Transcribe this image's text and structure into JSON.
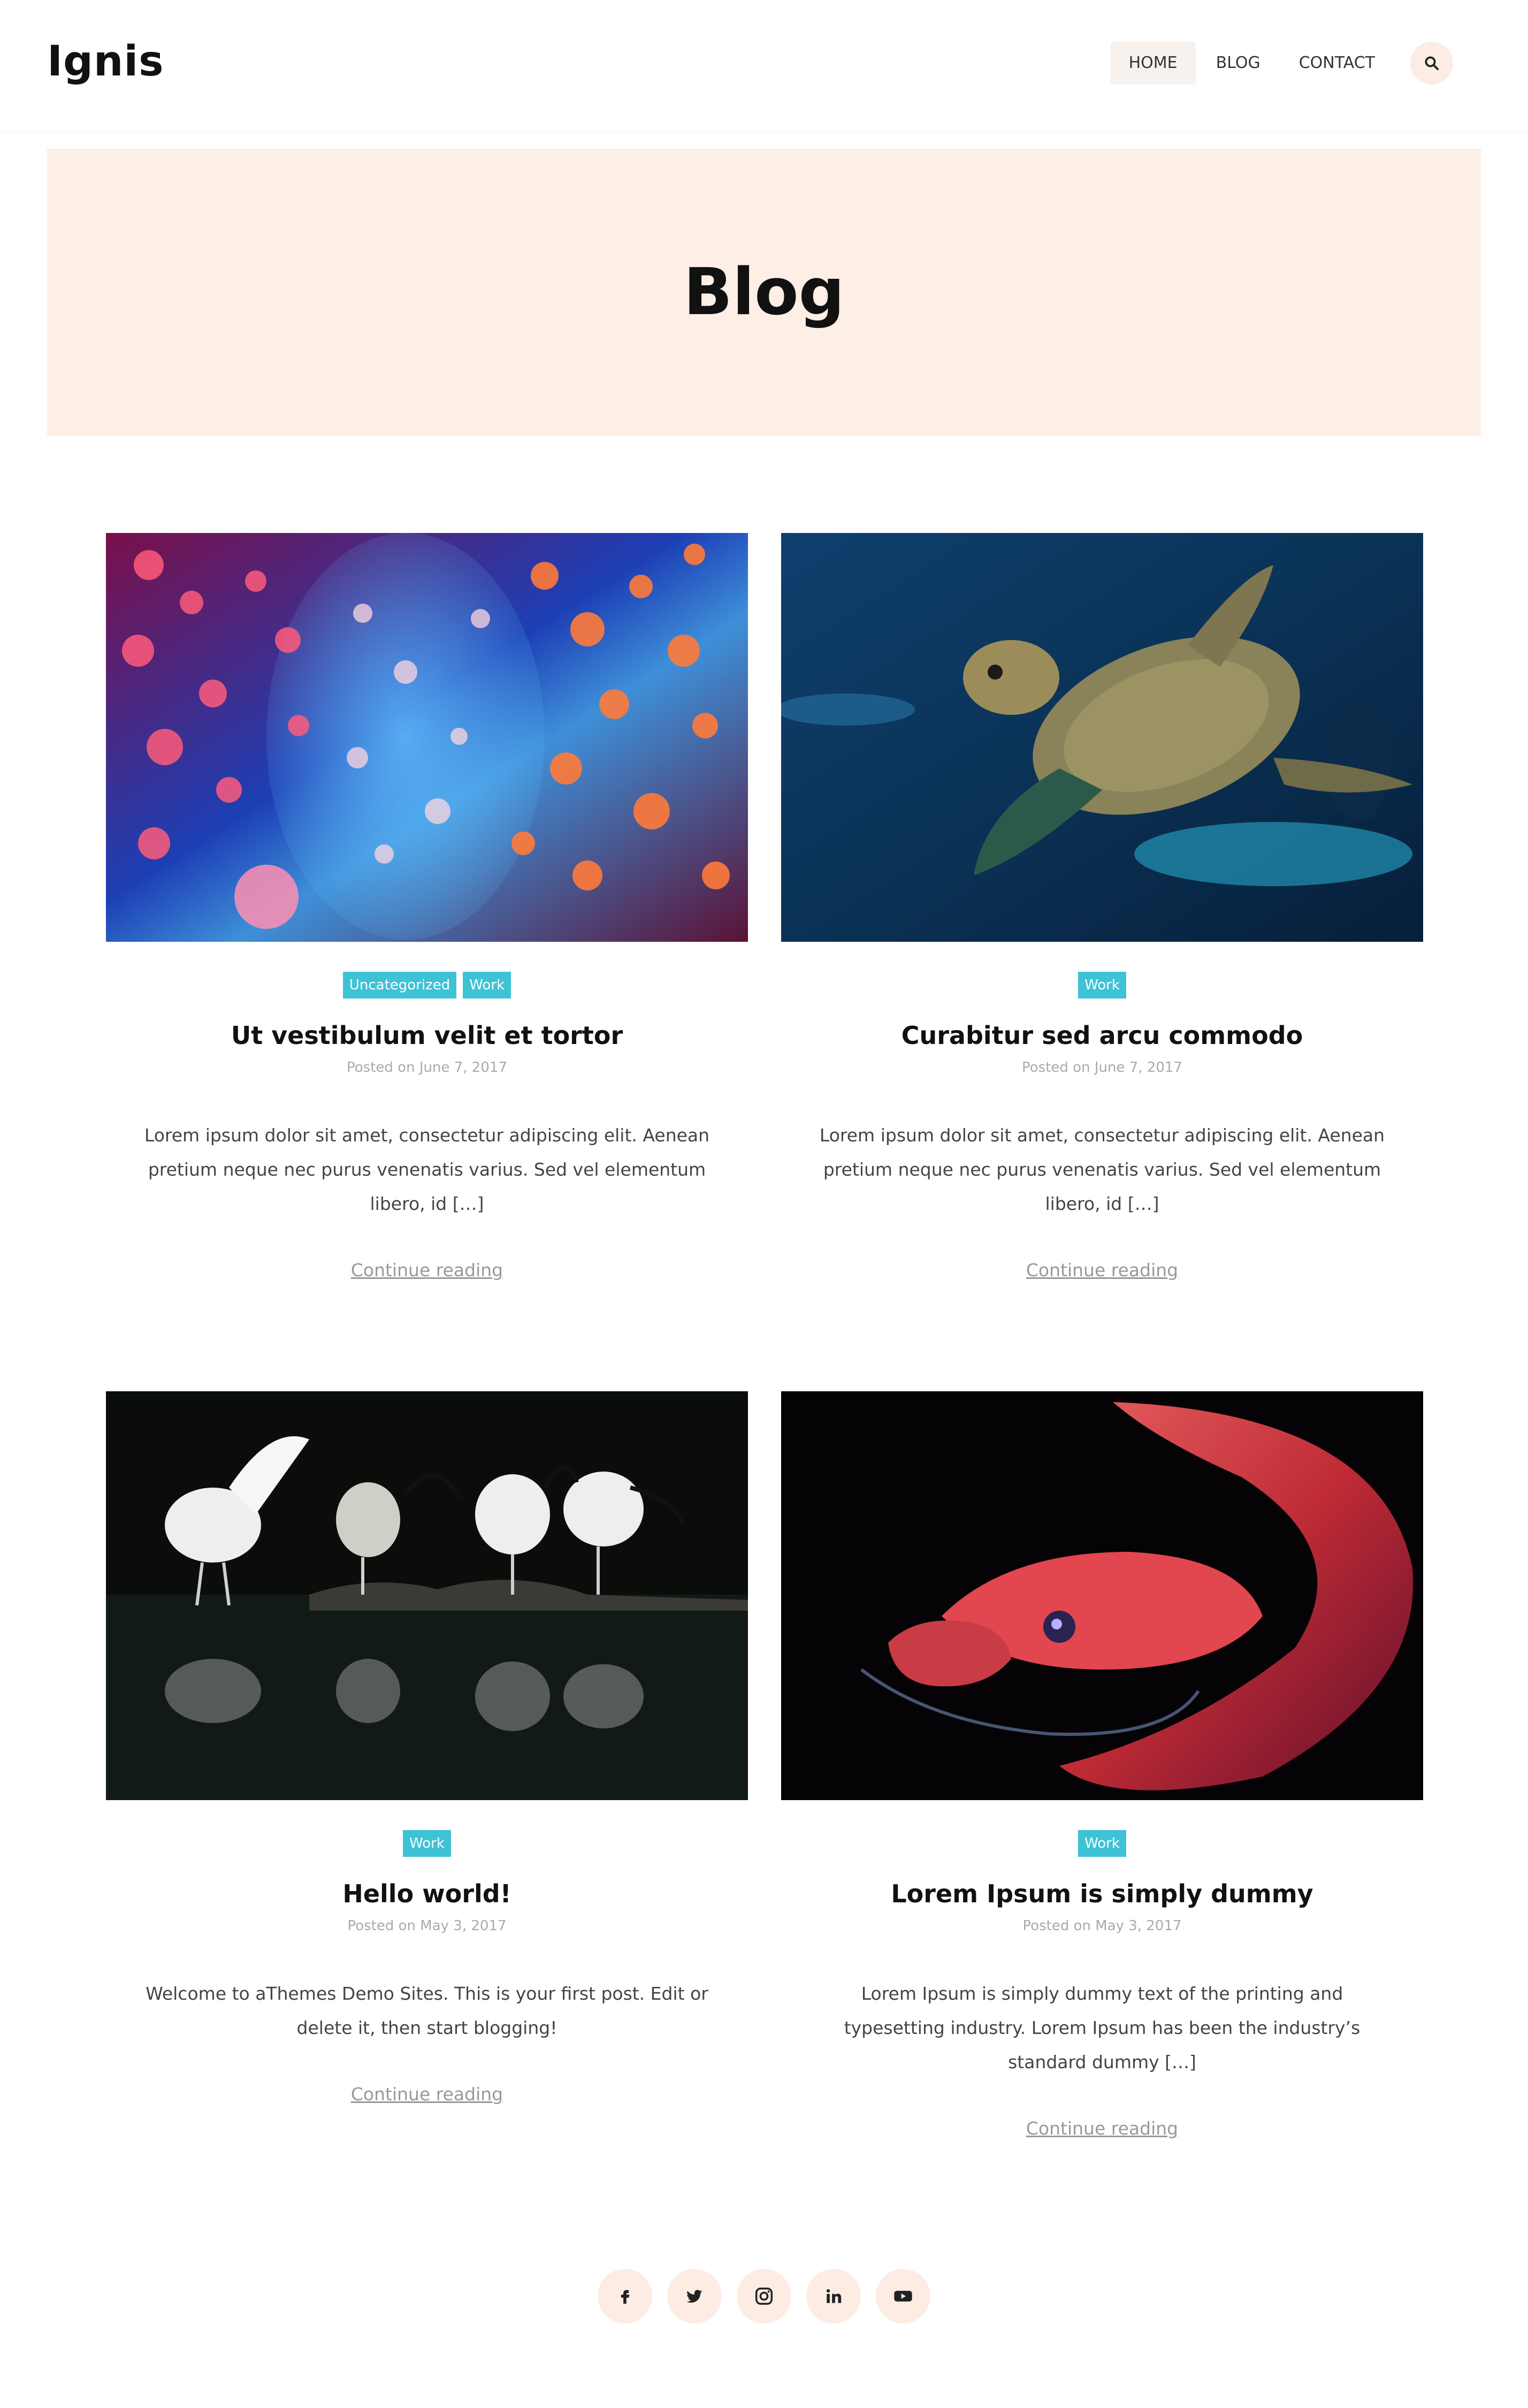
{
  "site": {
    "logo": "Ignis"
  },
  "nav": {
    "items": [
      "HOME",
      "BLOG",
      "CONTACT"
    ],
    "search_icon": "search-icon"
  },
  "hero": {
    "title": "Blog"
  },
  "posts": [
    {
      "categories": [
        "Uncategorized",
        "Work"
      ],
      "title": "Ut vestibulum velit et tortor",
      "date": "Posted on June 7, 2017",
      "excerpt": "Lorem ipsum dolor sit amet, consectetur adipiscing elit. Aenean pretium neque nec purus venenatis varius. Sed vel elementum libero, id […]",
      "continue": "Continue reading",
      "image": "jellyfish"
    },
    {
      "categories": [
        "Work"
      ],
      "title": "Curabitur sed arcu commodo",
      "date": "Posted on June 7, 2017",
      "excerpt": "Lorem ipsum dolor sit amet, consectetur adipiscing elit. Aenean pretium neque nec purus venenatis varius. Sed vel elementum libero, id […]",
      "continue": "Continue reading",
      "image": "sea-turtle"
    },
    {
      "categories": [
        "Work"
      ],
      "title": "Hello world!",
      "date": "Posted on May 3, 2017",
      "excerpt": "Welcome to aThemes Demo Sites. This is your first post. Edit or delete it, then start blogging!",
      "continue": "Continue reading",
      "image": "ibis-birds"
    },
    {
      "categories": [
        "Work"
      ],
      "title": "Lorem Ipsum is simply dummy",
      "date": "Posted on May 3, 2017",
      "excerpt": "Lorem Ipsum is simply dummy text of the printing and typesetting industry. Lorem Ipsum has been the industry’s standard dummy […]",
      "continue": "Continue reading",
      "image": "red-snake"
    }
  ],
  "social": [
    "facebook-icon",
    "twitter-icon",
    "instagram-icon",
    "linkedin-icon",
    "youtube-icon"
  ],
  "colors": {
    "accent": "#3ec2d6",
    "hero_bg": "#fdeee6",
    "icon_bg": "#fdece4"
  }
}
